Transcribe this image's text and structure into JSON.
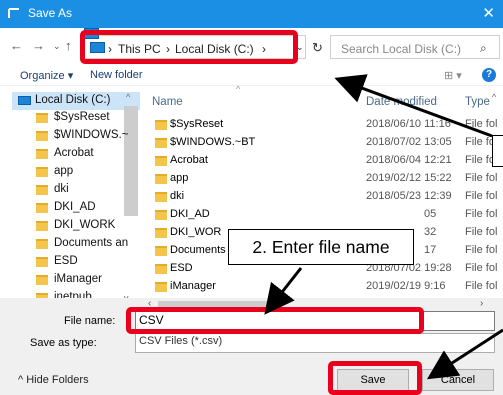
{
  "window": {
    "title": "Save As"
  },
  "address": {
    "breadcrumb": [
      "This PC",
      "Local Disk (C:)"
    ],
    "search_placeholder": "Search Local Disk (C:)"
  },
  "toolbar": {
    "organize": "Organize",
    "new_folder": "New folder"
  },
  "nav_pane": {
    "selected": "Local Disk (C:)",
    "items": [
      "$SysReset",
      "$WINDOWS.~",
      "Acrobat",
      "app",
      "dki",
      "DKI_AD",
      "DKI_WORK",
      "Documents an",
      "ESD",
      "iManager",
      "inetpub"
    ]
  },
  "columns": {
    "name": "Name",
    "date": "Date modified",
    "type": "Type"
  },
  "files": [
    {
      "name": "$SysReset",
      "date": "2018/06/10 11:16",
      "type": "File fol"
    },
    {
      "name": "$WINDOWS.~BT",
      "date": "2018/07/02 13:05",
      "type": "File fol"
    },
    {
      "name": "Acrobat",
      "date": "2018/06/04 12:21",
      "type": "File fol"
    },
    {
      "name": "app",
      "date": "2019/02/12 15:22",
      "type": "File fol"
    },
    {
      "name": "dki",
      "date": "2018/05/23 12:39",
      "type": "File fol"
    },
    {
      "name": "DKI_AD",
      "date": "05",
      "type": "File fol"
    },
    {
      "name": "DKI_WOR",
      "date": "32",
      "type": "File fol"
    },
    {
      "name": "Documents and Settings",
      "date": "17",
      "type": "File fol"
    },
    {
      "name": "ESD",
      "date": "2018/07/02 19:28",
      "type": "File fol"
    },
    {
      "name": "iManager",
      "date": "2019/02/19 9:16",
      "type": "File fol"
    }
  ],
  "form": {
    "file_name_label": "File name:",
    "file_name_value": "CSV",
    "save_as_type_label": "Save as type:",
    "save_as_type_value": "CSV Files (*.csv)"
  },
  "footer": {
    "hide_folders": "Hide Folders",
    "save": "Save",
    "cancel": "Cancel"
  },
  "annotation": {
    "step2": "2. Enter file name"
  },
  "colors": {
    "titlebar": "#1b8fe3",
    "highlight": "#e8001c",
    "selection": "#cce4f7",
    "folder": "#f3c54a"
  }
}
